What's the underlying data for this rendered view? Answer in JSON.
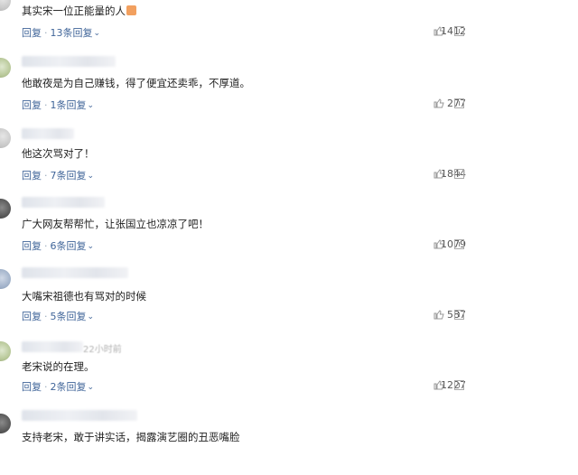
{
  "comments": [
    {
      "content": "其实宋一位正能量的人",
      "reply_label": "回复",
      "replies_label": "13条回复",
      "likes": "1412"
    },
    {
      "content": "他敢夜是为自己赚钱，得了便宜还卖乖，不厚道。",
      "reply_label": "回复",
      "replies_label": "1条回复",
      "likes": "277"
    },
    {
      "content": "他这次骂对了！",
      "reply_label": "回复",
      "replies_label": "7条回复",
      "likes": "1844"
    },
    {
      "content": "广大网友帮帮忙，让张国立也凉凉了吧！",
      "reply_label": "回复",
      "replies_label": "6条回复",
      "likes": "1079"
    },
    {
      "content": "大嘴宋祖德也有骂对的时候",
      "reply_label": "回复",
      "replies_label": "5条回复",
      "likes": "587"
    },
    {
      "meta_time": "22小时前",
      "content": "老宋说的在理。",
      "reply_label": "回复",
      "replies_label": "2条回复",
      "likes": "1227"
    },
    {
      "content": "支持老宋，敢于讲实话，揭露演艺圈的丑恶嘴脸",
      "reply_label": "回复",
      "replies_label": "",
      "likes": ""
    }
  ],
  "icons": {
    "like": "thumbs-up-icon",
    "more": "more-icon",
    "chevron": "chevron-down-icon"
  },
  "colors": {
    "link": "#406599",
    "text": "#222222",
    "muted": "#555555"
  }
}
